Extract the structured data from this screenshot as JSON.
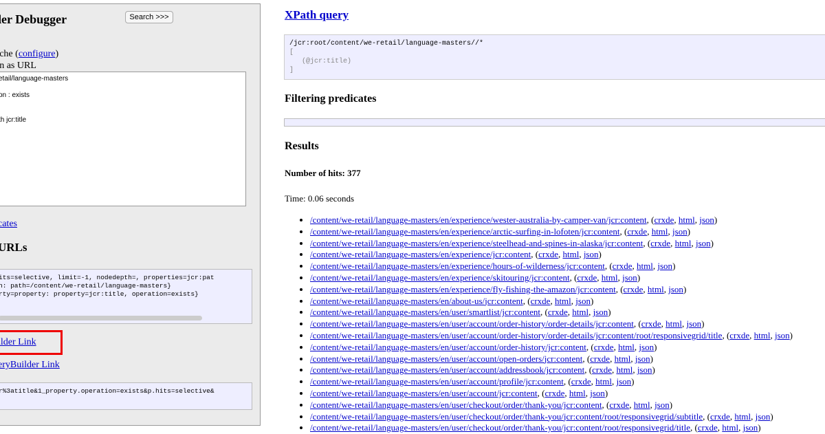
{
  "left_panel": {
    "title": "QueryBuilder Debugger",
    "search_button": "Search >>>",
    "options": {
      "opt1_text": "s",
      "opt2_prefix": "ache (",
      "opt2_link": "configure",
      "opt2_suffix": ")",
      "opt3_text": "en as URL"
    },
    "query_lines": [
      "etail/language-masters",
      "",
      "on : exists",
      "",
      "",
      "th jcr:title"
    ],
    "predicates_link": "cates",
    "urls_heading": "URLs",
    "code1_lines": [
      "its=selective, limit=-1, nodedepth=, properties=jcr:pat",
      "h: path=/content/we-retail/language-masters}",
      "rty=property: property=jcr:title, operation=exists}"
    ],
    "qb_link": "ilder Link",
    "qb_link2": "eryBuilder Link",
    "code2_line": "r%3atitle&1_property.operation=exists&p.hits=selective&"
  },
  "xpath": {
    "heading": "XPath query",
    "lines": [
      "/jcr:root/content/we-retail/language-masters//*",
      "[",
      "   (@jcr:title)",
      "]"
    ]
  },
  "filtering": {
    "heading": "Filtering predicates"
  },
  "results": {
    "heading": "Results",
    "hits": "Number of hits: 377",
    "time": "Time: 0.06 seconds",
    "items": [
      {
        "path": "/content/we-retail/language-masters/en/experience/wester-australia-by-camper-van/jcr:content"
      },
      {
        "path": "/content/we-retail/language-masters/en/experience/arctic-surfing-in-lofoten/jcr:content"
      },
      {
        "path": "/content/we-retail/language-masters/en/experience/steelhead-and-spines-in-alaska/jcr:content"
      },
      {
        "path": "/content/we-retail/language-masters/en/experience/jcr:content"
      },
      {
        "path": "/content/we-retail/language-masters/en/experience/hours-of-wilderness/jcr:content"
      },
      {
        "path": "/content/we-retail/language-masters/en/experience/skitouring/jcr:content"
      },
      {
        "path": "/content/we-retail/language-masters/en/experience/fly-fishing-the-amazon/jcr:content"
      },
      {
        "path": "/content/we-retail/language-masters/en/about-us/jcr:content"
      },
      {
        "path": "/content/we-retail/language-masters/en/user/smartlist/jcr:content"
      },
      {
        "path": "/content/we-retail/language-masters/en/user/account/order-history/order-details/jcr:content"
      },
      {
        "path": "/content/we-retail/language-masters/en/user/account/order-history/order-details/jcr:content/root/responsivegrid/title"
      },
      {
        "path": "/content/we-retail/language-masters/en/user/account/order-history/jcr:content"
      },
      {
        "path": "/content/we-retail/language-masters/en/user/account/open-orders/jcr:content"
      },
      {
        "path": "/content/we-retail/language-masters/en/user/account/addressbook/jcr:content"
      },
      {
        "path": "/content/we-retail/language-masters/en/user/account/profile/jcr:content"
      },
      {
        "path": "/content/we-retail/language-masters/en/user/account/jcr:content"
      },
      {
        "path": "/content/we-retail/language-masters/en/user/checkout/order/thank-you/jcr:content"
      },
      {
        "path": "/content/we-retail/language-masters/en/user/checkout/order/thank-you/jcr:content/root/responsivegrid/subtitle"
      },
      {
        "path": "/content/we-retail/language-masters/en/user/checkout/order/thank-you/jcr:content/root/responsivegrid/title"
      }
    ],
    "link_labels": {
      "crxde": "crxde",
      "html": "html",
      "json": "json"
    }
  }
}
